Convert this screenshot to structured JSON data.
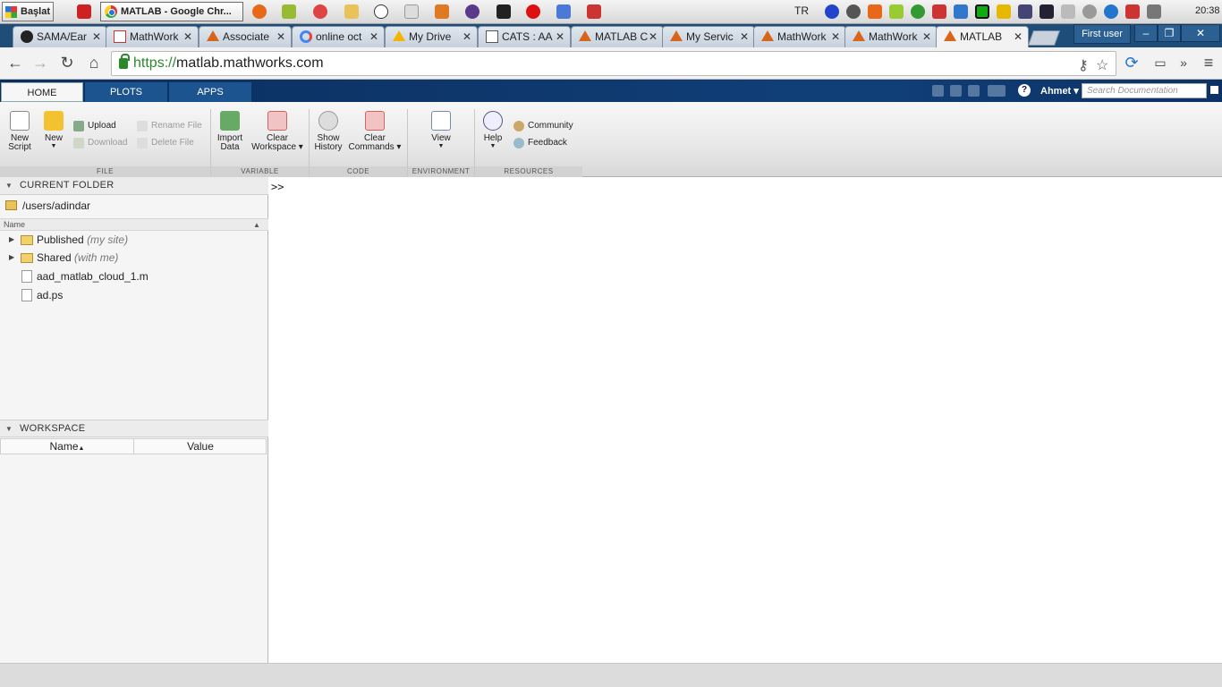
{
  "taskbar": {
    "start_label": "Başlat",
    "active_window": "MATLAB - Google Chr...",
    "language": "TR",
    "clock": "20:38"
  },
  "browser": {
    "tabs": [
      {
        "label": "SAMA/Ear",
        "icon": "github-icon"
      },
      {
        "label": "MathWork",
        "icon": "gmail-icon"
      },
      {
        "label": "Associate",
        "icon": "matlab-icon"
      },
      {
        "label": "online oct",
        "icon": "google-icon"
      },
      {
        "label": "My Drive",
        "icon": "drive-icon"
      },
      {
        "label": "CATS : AA",
        "icon": "cats-icon"
      },
      {
        "label": "MATLAB C",
        "icon": "matlab-icon"
      },
      {
        "label": "My Servic",
        "icon": "matlab-icon"
      },
      {
        "label": "MathWork",
        "icon": "matlab-icon"
      },
      {
        "label": "MathWork",
        "icon": "matlab-icon"
      },
      {
        "label": "MATLAB",
        "icon": "matlab-icon"
      }
    ],
    "profile": "First user",
    "url_scheme": "https://",
    "url_host": "matlab.mathworks.com"
  },
  "matlab": {
    "tabs": [
      "HOME",
      "PLOTS",
      "APPS"
    ],
    "user": "Ahmet",
    "search_placeholder": "Search Documentation",
    "ribbon": {
      "file": {
        "label": "FILE",
        "new_script": [
          "New",
          "Script"
        ],
        "new": "New",
        "upload": "Upload",
        "download": "Download",
        "rename": "Rename File",
        "delete": "Delete File"
      },
      "variable": {
        "label": "VARIABLE",
        "import": [
          "Import",
          "Data"
        ],
        "clear_ws": [
          "Clear",
          "Workspace"
        ]
      },
      "code": {
        "label": "CODE",
        "history": [
          "Show",
          "History"
        ],
        "clear_cmd": [
          "Clear",
          "Commands"
        ]
      },
      "environment": {
        "label": "ENVIRONMENT",
        "view": "View"
      },
      "resources": {
        "label": "RESOURCES",
        "help": "Help",
        "community": "Community",
        "feedback": "Feedback"
      }
    },
    "current_folder": {
      "title": "CURRENT FOLDER",
      "path": "/users/adindar",
      "col_name": "Name",
      "items": [
        {
          "name": "Published",
          "sub": "(my site)",
          "type": "folder"
        },
        {
          "name": "Shared",
          "sub": "(with me)",
          "type": "folder"
        },
        {
          "name": "aad_matlab_cloud_1.m",
          "sub": "",
          "type": "mfile"
        },
        {
          "name": "ad.ps",
          "sub": "",
          "type": "file"
        }
      ]
    },
    "workspace": {
      "title": "WORKSPACE",
      "col_name": "Name",
      "col_value": "Value"
    },
    "command_prompt": ">>"
  }
}
